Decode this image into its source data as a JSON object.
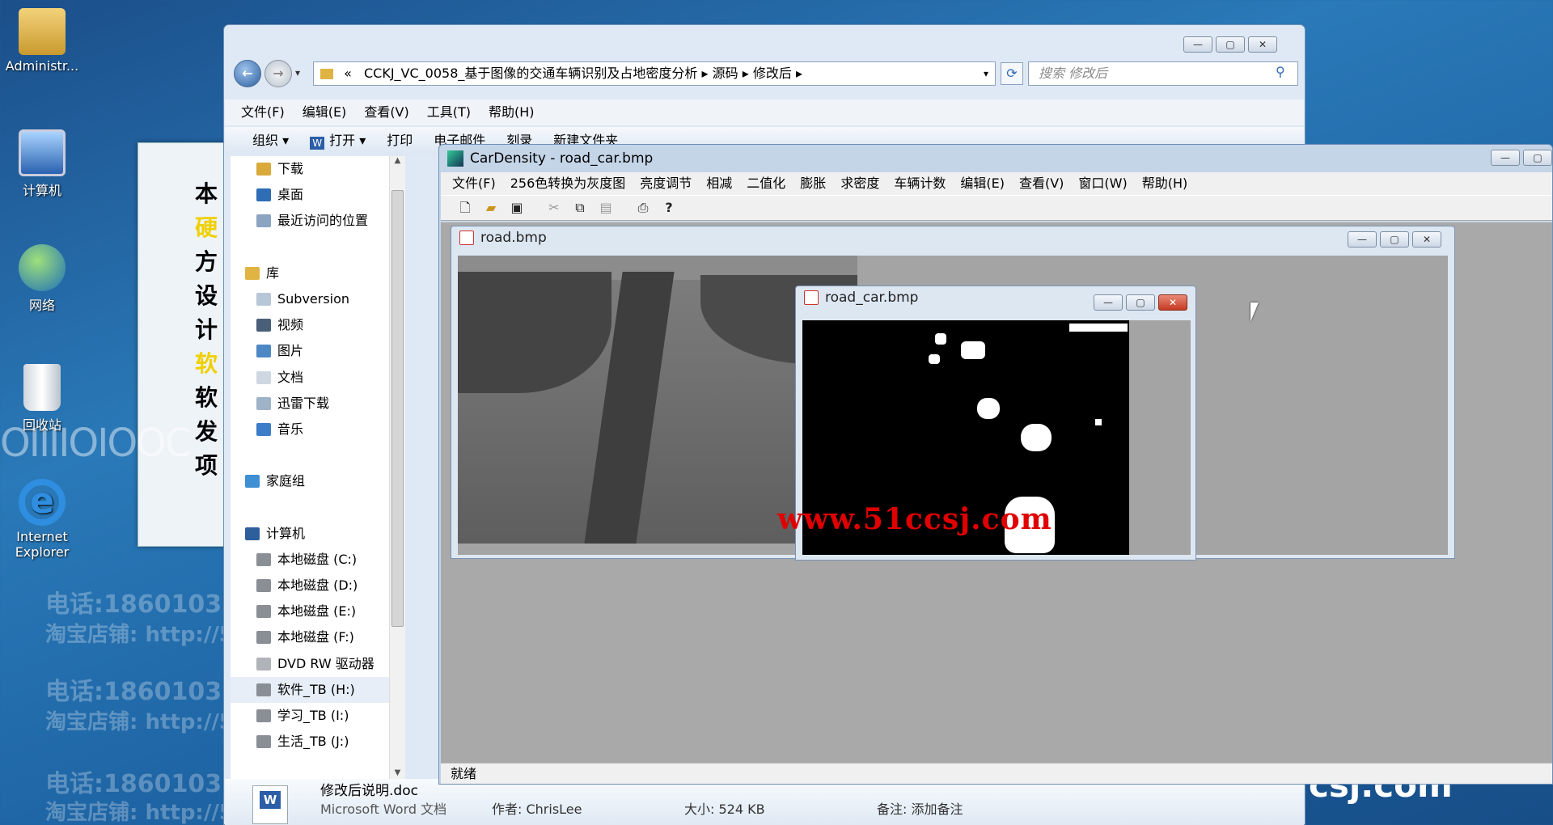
{
  "desktop": {
    "icons": [
      {
        "label": "Administr..."
      },
      {
        "label": "计算机"
      },
      {
        "label": "网络"
      },
      {
        "label": "回收站"
      },
      {
        "label": "Internet"
      },
      {
        "label": "Explorer"
      }
    ],
    "panel_chars": [
      "本",
      "硬",
      "方",
      "设",
      "计",
      "",
      "软",
      "软",
      "发",
      "项"
    ],
    "watermark": {
      "phone": "电话:1860103",
      "shop": "淘宝店铺: http://5",
      "binary": "OIIIIOIOOC"
    },
    "bottom_right_text": "csj.com"
  },
  "explorer": {
    "address_prefix": "«",
    "breadcrumb": [
      "CCKJ_VC_0058_基于图像的交通车辆识别及占地密度分析",
      "源码",
      "修改后"
    ],
    "search_placeholder": "搜索 修改后",
    "menu": [
      "文件(F)",
      "编辑(E)",
      "查看(V)",
      "工具(T)",
      "帮助(H)"
    ],
    "commands": [
      "组织 ▾",
      "打开 ▾",
      "打印",
      "电子邮件",
      "刻录",
      "新建文件夹"
    ],
    "nav_items": [
      {
        "label": "下载",
        "color": "#d9a93b",
        "indent": true
      },
      {
        "label": "桌面",
        "color": "#2f6db5",
        "indent": true
      },
      {
        "label": "最近访问的位置",
        "color": "#8aa4c2",
        "indent": true
      },
      {
        "label": "",
        "color": "",
        "indent": false
      },
      {
        "label": "库",
        "color": "#e0b443",
        "indent": false
      },
      {
        "label": "Subversion",
        "color": "#b7c7d8",
        "indent": true
      },
      {
        "label": "视频",
        "color": "#4a5f78",
        "indent": true
      },
      {
        "label": "图片",
        "color": "#4e88c4",
        "indent": true
      },
      {
        "label": "文档",
        "color": "#cfd8e2",
        "indent": true
      },
      {
        "label": "迅雷下载",
        "color": "#9fb3c8",
        "indent": true
      },
      {
        "label": "音乐",
        "color": "#3d7cc9",
        "indent": true
      },
      {
        "label": "",
        "color": "",
        "indent": false
      },
      {
        "label": "家庭组",
        "color": "#3e8fd3",
        "indent": false
      },
      {
        "label": "",
        "color": "",
        "indent": false
      },
      {
        "label": "计算机",
        "color": "#2d5f9c",
        "indent": false
      },
      {
        "label": "本地磁盘 (C:)",
        "color": "#8a8f96",
        "indent": true
      },
      {
        "label": "本地磁盘 (D:)",
        "color": "#8a8f96",
        "indent": true
      },
      {
        "label": "本地磁盘 (E:)",
        "color": "#8a8f96",
        "indent": true
      },
      {
        "label": "本地磁盘 (F:)",
        "color": "#8a8f96",
        "indent": true
      },
      {
        "label": "DVD RW 驱动器",
        "color": "#b0b4b8",
        "indent": true
      },
      {
        "label": "软件_TB (H:)",
        "color": "#8a8f96",
        "indent": true,
        "selected": true
      },
      {
        "label": "学习_TB (I:)",
        "color": "#8a8f96",
        "indent": true
      },
      {
        "label": "生活_TB (J:)",
        "color": "#8a8f96",
        "indent": true
      }
    ],
    "details": {
      "filename": "修改后说明.doc",
      "filetype": "Microsoft Word 文档",
      "author": "作者: ChrisLee",
      "size": "大小: 524 KB",
      "notes": "备注: 添加备注"
    }
  },
  "app": {
    "title": "CarDensity - road_car.bmp",
    "menu": [
      "文件(F)",
      "256色转换为灰度图",
      "亮度调节",
      "相减",
      "二值化",
      "膨胀",
      "求密度",
      "车辆计数",
      "编辑(E)",
      "查看(V)",
      "窗口(W)",
      "帮助(H)"
    ],
    "toolbar_icons": [
      "new-icon",
      "open-icon",
      "save-icon",
      "cut-icon",
      "copy-icon",
      "paste-icon",
      "print-icon",
      "help-icon"
    ],
    "status": "就绪",
    "child_road_title": "road.bmp",
    "child_car_title": "road_car.bmp",
    "overlay_url": "www.51ccsj.com"
  },
  "colors": {
    "desktop_blue": "#1f66a6",
    "close_red": "#c63a22",
    "url_red": "#e00000"
  }
}
